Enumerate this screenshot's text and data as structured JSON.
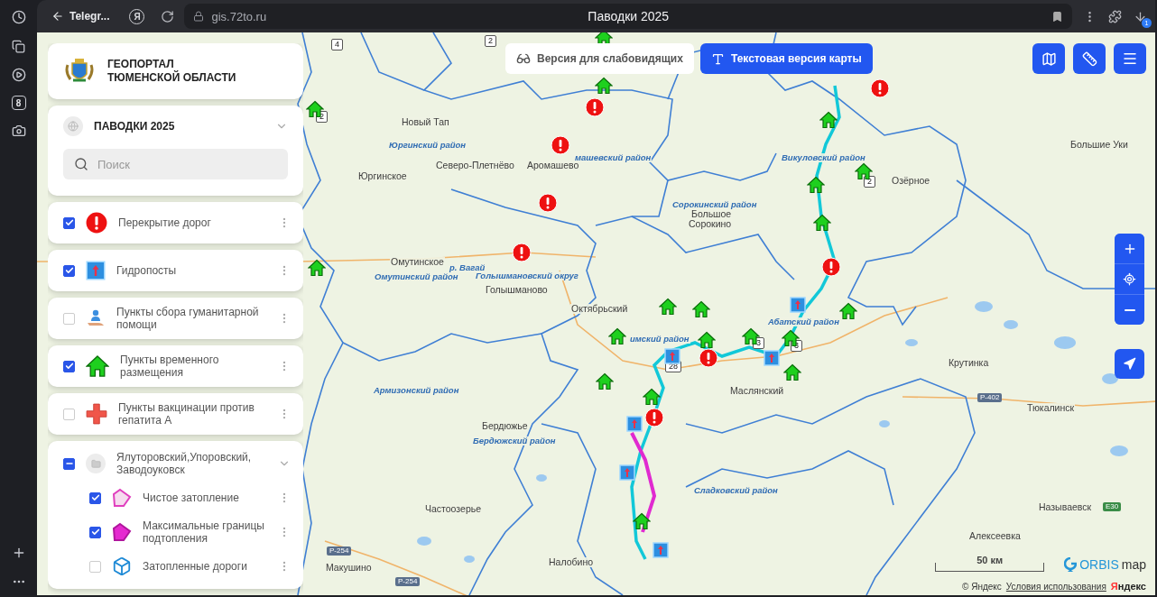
{
  "browser": {
    "sidebar_badge": "8",
    "back_tab": "Telegr...",
    "logo": "Я",
    "url": "gis.72to.ru",
    "page_title": "Паводки 2025",
    "downloads_badge": "1"
  },
  "portal": {
    "title_lines": [
      "ГЕОПОРТАЛ",
      "ТЮМЕНСКОЙ ОБЛАСТИ"
    ]
  },
  "project": {
    "title": "ПАВОДКИ 2025",
    "search": {
      "placeholder": "Поиск"
    }
  },
  "layers": [
    {
      "kind": "road-closure",
      "label": "Перекрытие дорог",
      "checked": true
    },
    {
      "kind": "gauge",
      "label": "Гидропосты",
      "checked": true
    },
    {
      "kind": "aid-point",
      "label": "Пункты сбора гуманитарной помощи",
      "checked": false
    },
    {
      "kind": "shelter",
      "label": "Пункты временного размещения",
      "checked": true
    },
    {
      "kind": "vaccination",
      "label": "Пункты вакцинации против гепатита А",
      "checked": false
    }
  ],
  "layer_group": {
    "label": "Ялуторовский,Упоровский, Заводоуковск",
    "checked": true,
    "partial": true,
    "expanded": true,
    "children": [
      {
        "kind": "clean-flood",
        "label": "Чистое затопление",
        "checked": true
      },
      {
        "kind": "max-flood",
        "label": "Максимальные границы подтопления",
        "checked": true
      },
      {
        "kind": "flooded-roads",
        "label": "Затопленные дороги",
        "checked": false
      }
    ]
  },
  "top_buttons": [
    {
      "kind": "low-vision",
      "label": "Версия для слабовидящих",
      "primary": false
    },
    {
      "kind": "text-version",
      "label": "Текстовая версия карты",
      "primary": true
    }
  ],
  "map": {
    "place_labels": [
      {
        "text": "Новый Тап",
        "kind": "town"
      },
      {
        "text": "Юргинский район",
        "kind": "district"
      },
      {
        "text": "Юргинское",
        "kind": "town"
      },
      {
        "text": "Северо-Плетнёво",
        "kind": "town"
      },
      {
        "text": "Аромашево",
        "kind": "town"
      },
      {
        "text": "машевский район",
        "kind": "district"
      },
      {
        "text": "Викуловский район",
        "kind": "district"
      },
      {
        "text": "Озёрное",
        "kind": "town"
      },
      {
        "text": "Большие Уки",
        "kind": "town"
      },
      {
        "text": "Сорокинский район",
        "kind": "district"
      },
      {
        "text": "Большое",
        "kind": "town"
      },
      {
        "text": "Сорокино",
        "kind": "town"
      },
      {
        "text": "Омутинское",
        "kind": "town"
      },
      {
        "text": "Омутинский район",
        "kind": "district"
      },
      {
        "text": "р. Вагай",
        "kind": "district"
      },
      {
        "text": "Голышмановский округ",
        "kind": "district"
      },
      {
        "text": "Голышманово",
        "kind": "town"
      },
      {
        "text": "Октябрьский",
        "kind": "town"
      },
      {
        "text": "Абатский район",
        "kind": "district"
      },
      {
        "text": "имский район",
        "kind": "district"
      },
      {
        "text": "Маслянский",
        "kind": "town"
      },
      {
        "text": "Армизонский район",
        "kind": "district"
      },
      {
        "text": "Крутинка",
        "kind": "town"
      },
      {
        "text": "Тюкалинск",
        "kind": "town"
      },
      {
        "text": "Бердюжье",
        "kind": "town"
      },
      {
        "text": "Бердюжский район",
        "kind": "district"
      },
      {
        "text": "Сладковский район",
        "kind": "district"
      },
      {
        "text": "Называевск",
        "kind": "town"
      },
      {
        "text": "Частоозерье",
        "kind": "town"
      },
      {
        "text": "Алексеевка",
        "kind": "town"
      },
      {
        "text": "Макушино",
        "kind": "town"
      },
      {
        "text": "Налобино",
        "kind": "town"
      }
    ],
    "road_labels": [
      {
        "text": "Р-402",
        "kind": "federal"
      },
      {
        "text": "Р-254",
        "kind": "federal"
      },
      {
        "text": "Р-254",
        "kind": "federal"
      },
      {
        "text": "E30",
        "kind": "euro"
      }
    ],
    "route_shields": [
      "2",
      "3",
      "3",
      "28",
      "4",
      "2",
      "2"
    ]
  },
  "scale": "50 км",
  "brand": {
    "first": "ORBIS",
    "rest": "map"
  },
  "attribution": {
    "copyright": "© Яндекс",
    "terms_link": "Условия использования",
    "logo_first": "Я",
    "logo_rest": "ндекс"
  }
}
